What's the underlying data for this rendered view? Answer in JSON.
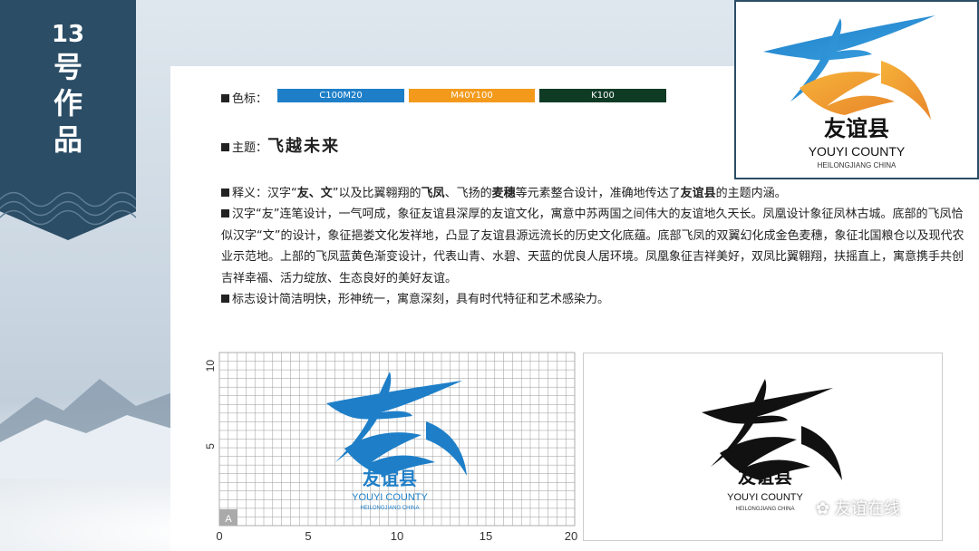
{
  "badge": {
    "number": "13",
    "chars": [
      "号",
      "作",
      "品"
    ]
  },
  "color_label": {
    "prefix": "色标：",
    "bars": [
      {
        "text": "C100M20",
        "color": "#1e7fc8"
      },
      {
        "text": "M40Y100",
        "color": "#f39a1c"
      },
      {
        "text": "K100",
        "color": "#0f3b25"
      }
    ]
  },
  "theme": {
    "prefix": "主题：",
    "title": "飞越未来"
  },
  "para": {
    "p1_a": "释义：汉字“",
    "p1_b": "友",
    "p1_c": "、",
    "p1_d": "文",
    "p1_e": "”以及比翼翱翔的",
    "p1_f": "飞凤",
    "p1_g": "、飞扬的",
    "p1_h": "麦穗",
    "p1_i": "等元素整合设计，准确地传达了",
    "p1_j": "友谊县",
    "p1_k": "的主题内涵。",
    "p2": "汉字“友”连笔设计，一气呵成，象征友谊县深厚的友谊文化，寓意中苏两国之间伟大的友谊地久天长。凤凰设计象征凤林古城。底部的飞凤恰似汉字“文”的设计，象征挹娄文化发祥地，凸显了友谊县源远流长的历史文化底蕴。底部飞凤的双翼幻化成金色麦穗，象征北国粮仓以及现代农业示范地。上部的飞凤蓝黄色渐变设计，代表山青、水碧、天蓝的优良人居环境。凤凰象征吉祥美好，双凤比翼翱翔，扶摇直上，寓意携手共创吉祥幸福、活力绽放、生态良好的美好友谊。",
    "p3": "标志设计简洁明快，形神统一，寓意深刻，具有时代特征和艺术感染力。"
  },
  "logo": {
    "cn": "友谊县",
    "en": "YOUYI COUNTY",
    "sub": "HEILONGJIANG CHINA"
  },
  "grid": {
    "y_ticks": [
      "10",
      "5"
    ],
    "x_ticks": [
      "0",
      "5",
      "10",
      "15",
      "20"
    ],
    "corner": "A"
  },
  "watermark": "友谊在线"
}
